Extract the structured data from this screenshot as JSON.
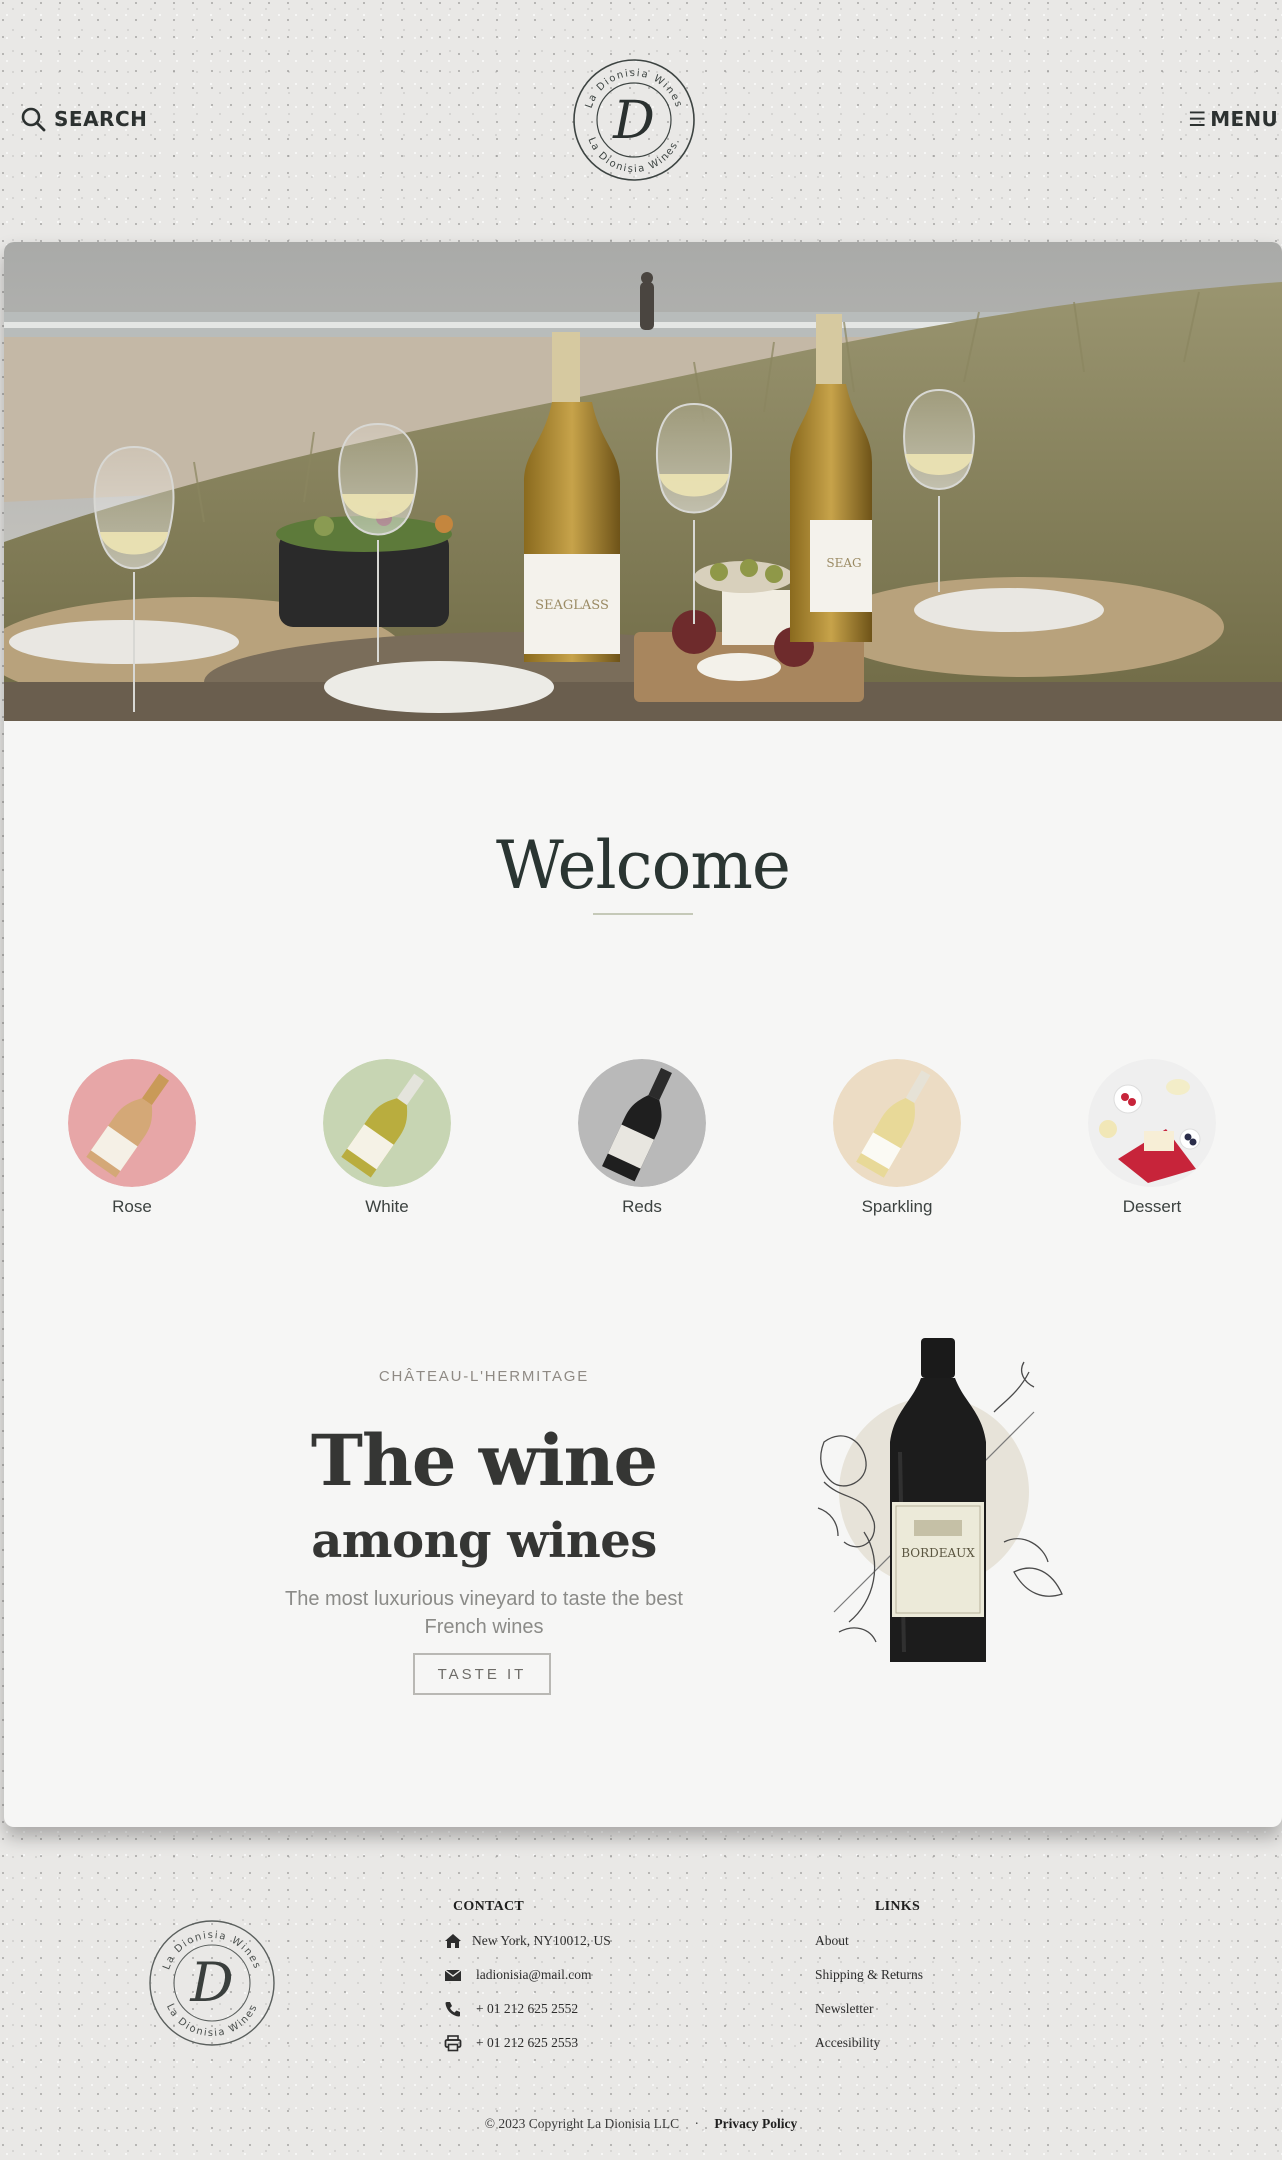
{
  "header": {
    "search_label": "SEARCH",
    "menu_label": "MENU",
    "logo": {
      "monogram": "D",
      "ring_text": "La Dionisia Wines",
      "ring_text_bottom": "La Dionisia Wines."
    }
  },
  "hero": {
    "bottle_label": "SEAGLASS",
    "bottle_label_2": "SEAG"
  },
  "welcome": {
    "title": "Welcome"
  },
  "categories": [
    {
      "label": "Rose",
      "color": "#e7a6a7"
    },
    {
      "label": "White",
      "color": "#c7d5b3"
    },
    {
      "label": "Reds",
      "color": "#b9b9b9"
    },
    {
      "label": "Sparkling",
      "color": "#ecdcc4"
    },
    {
      "label": "Dessert",
      "color": "#efefef"
    }
  ],
  "feature": {
    "eyebrow": "CHÂTEAU-L'HERMITAGE",
    "title": "The wine",
    "subtitle": "among wines",
    "tagline": "The most luxurious vineyard to taste the best French wines",
    "cta_label": "TASTE IT",
    "bottle_label": "BORDEAUX"
  },
  "footer": {
    "contact_heading": "CONTACT",
    "links_heading": "LINKS",
    "contact": {
      "address": "New York, NY10012, US",
      "email": "ladionisia@mail.com",
      "phone": "+ 01 212 625 2552",
      "fax": "+ 01 212 625 2553"
    },
    "links": [
      "About",
      "Shipping & Returns",
      "Newsletter",
      "Accesibility"
    ],
    "copyright": "© 2023 Copyright  La Dionisia LLC",
    "privacy": "Privacy Policy"
  },
  "colors": {
    "ink": "#2c3130",
    "accent_rule": "#c5c9b8",
    "card_bg": "#f6f6f5"
  }
}
